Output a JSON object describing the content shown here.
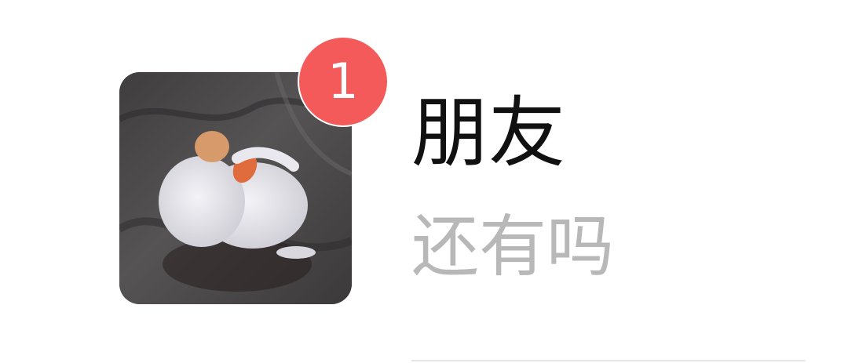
{
  "conversation": {
    "contact_name": "朋友",
    "last_message": "还有吗",
    "unread_count": "1",
    "avatar_icon": "plush-duck-photo-avatar"
  },
  "colors": {
    "badge": "#f35a59",
    "name_text": "#111111",
    "preview_text": "#b8b8b8",
    "divider": "#e6e6e6"
  }
}
